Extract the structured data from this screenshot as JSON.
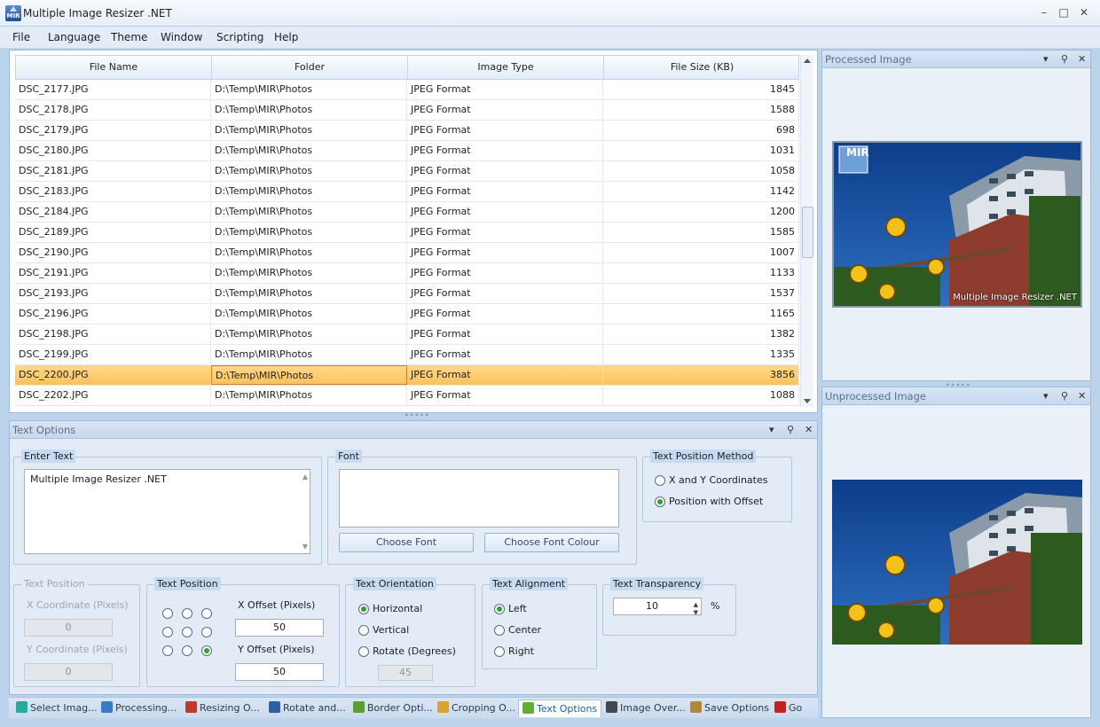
{
  "app": {
    "title": "Multiple Image Resizer .NET",
    "icon_text": "MIR"
  },
  "window_controls": {
    "minimize": "–",
    "maximize": "□",
    "close": "✕"
  },
  "menu": [
    "File",
    "Language",
    "Theme",
    "Window",
    "Scripting",
    "Help"
  ],
  "grid": {
    "columns": [
      "File Name",
      "Folder",
      "Image Type",
      "File Size (KB)"
    ],
    "rows": [
      [
        "DSC_2177.JPG",
        "D:\\Temp\\MIR\\Photos",
        "JPEG Format",
        "1845"
      ],
      [
        "DSC_2178.JPG",
        "D:\\Temp\\MIR\\Photos",
        "JPEG Format",
        "1588"
      ],
      [
        "DSC_2179.JPG",
        "D:\\Temp\\MIR\\Photos",
        "JPEG Format",
        "698"
      ],
      [
        "DSC_2180.JPG",
        "D:\\Temp\\MIR\\Photos",
        "JPEG Format",
        "1031"
      ],
      [
        "DSC_2181.JPG",
        "D:\\Temp\\MIR\\Photos",
        "JPEG Format",
        "1058"
      ],
      [
        "DSC_2183.JPG",
        "D:\\Temp\\MIR\\Photos",
        "JPEG Format",
        "1142"
      ],
      [
        "DSC_2184.JPG",
        "D:\\Temp\\MIR\\Photos",
        "JPEG Format",
        "1200"
      ],
      [
        "DSC_2189.JPG",
        "D:\\Temp\\MIR\\Photos",
        "JPEG Format",
        "1585"
      ],
      [
        "DSC_2190.JPG",
        "D:\\Temp\\MIR\\Photos",
        "JPEG Format",
        "1007"
      ],
      [
        "DSC_2191.JPG",
        "D:\\Temp\\MIR\\Photos",
        "JPEG Format",
        "1133"
      ],
      [
        "DSC_2193.JPG",
        "D:\\Temp\\MIR\\Photos",
        "JPEG Format",
        "1537"
      ],
      [
        "DSC_2196.JPG",
        "D:\\Temp\\MIR\\Photos",
        "JPEG Format",
        "1165"
      ],
      [
        "DSC_2198.JPG",
        "D:\\Temp\\MIR\\Photos",
        "JPEG Format",
        "1382"
      ],
      [
        "DSC_2199.JPG",
        "D:\\Temp\\MIR\\Photos",
        "JPEG Format",
        "1335"
      ],
      [
        "DSC_2200.JPG",
        "D:\\Temp\\MIR\\Photos",
        "JPEG Format",
        "3856"
      ],
      [
        "DSC_2202.JPG",
        "D:\\Temp\\MIR\\Photos",
        "JPEG Format",
        "1088"
      ]
    ],
    "selected_row": 14
  },
  "text_options": {
    "title": "Text Options",
    "enter_text": {
      "title": "Enter Text",
      "value": "Multiple Image Resizer .NET"
    },
    "font": {
      "title": "Font",
      "choose_font": "Choose Font",
      "choose_colour": "Choose Font Colour"
    },
    "position_method": {
      "title": "Text Position Method",
      "opt_xy": "X and Y Coordinates",
      "opt_offset": "Position with Offset",
      "selected": "offset"
    },
    "coord_position": {
      "title": "Text Position",
      "x_label": "X Coordinate (Pixels)",
      "x_value": "0",
      "y_label": "Y Coordinate (Pixels)",
      "y_value": "0"
    },
    "offset_position": {
      "title": "Text Position",
      "x_label": "X Offset (Pixels)",
      "x_value": "50",
      "y_label": "Y Offset (Pixels)",
      "y_value": "50",
      "selected_anchor": 8
    },
    "orientation": {
      "title": "Text Orientation",
      "opt_h": "Horizontal",
      "opt_v": "Vertical",
      "opt_r": "Rotate (Degrees)",
      "degrees": "45",
      "selected": "horizontal"
    },
    "alignment": {
      "title": "Text Alignment",
      "opt_left": "Left",
      "opt_center": "Center",
      "opt_right": "Right",
      "selected": "left"
    },
    "transparency": {
      "title": "Text Transparency",
      "value": "10",
      "unit": "%"
    }
  },
  "tabs": [
    {
      "label": "Select Imag...",
      "color": "#2aa8a0"
    },
    {
      "label": "Processing...",
      "color": "#3a7bc8"
    },
    {
      "label": "Resizing O...",
      "color": "#c0392b"
    },
    {
      "label": "Rotate and...",
      "color": "#2d5fa8"
    },
    {
      "label": "Border Opti...",
      "color": "#5a9e3a"
    },
    {
      "label": "Cropping O...",
      "color": "#e0a030"
    },
    {
      "label": "Text Options",
      "color": "#5fb030"
    },
    {
      "label": "Image Over...",
      "color": "#404850"
    },
    {
      "label": "Save Options",
      "color": "#b08840"
    },
    {
      "label": "Go",
      "color": "#c82020"
    }
  ],
  "active_tab": 6,
  "processed": {
    "title": "Processed Image",
    "logo_text": "MIR",
    "watermark": "Multiple Image Resizer .NET"
  },
  "unprocessed": {
    "title": "Unprocessed Image"
  },
  "pane_icons": {
    "dropdown": "chevron-down-icon",
    "pin": "pin-icon",
    "close": "close-icon"
  },
  "colors": {
    "selection": "#fbc25d",
    "accent": "#1e60b6",
    "radio_on": "#2ca42c"
  }
}
